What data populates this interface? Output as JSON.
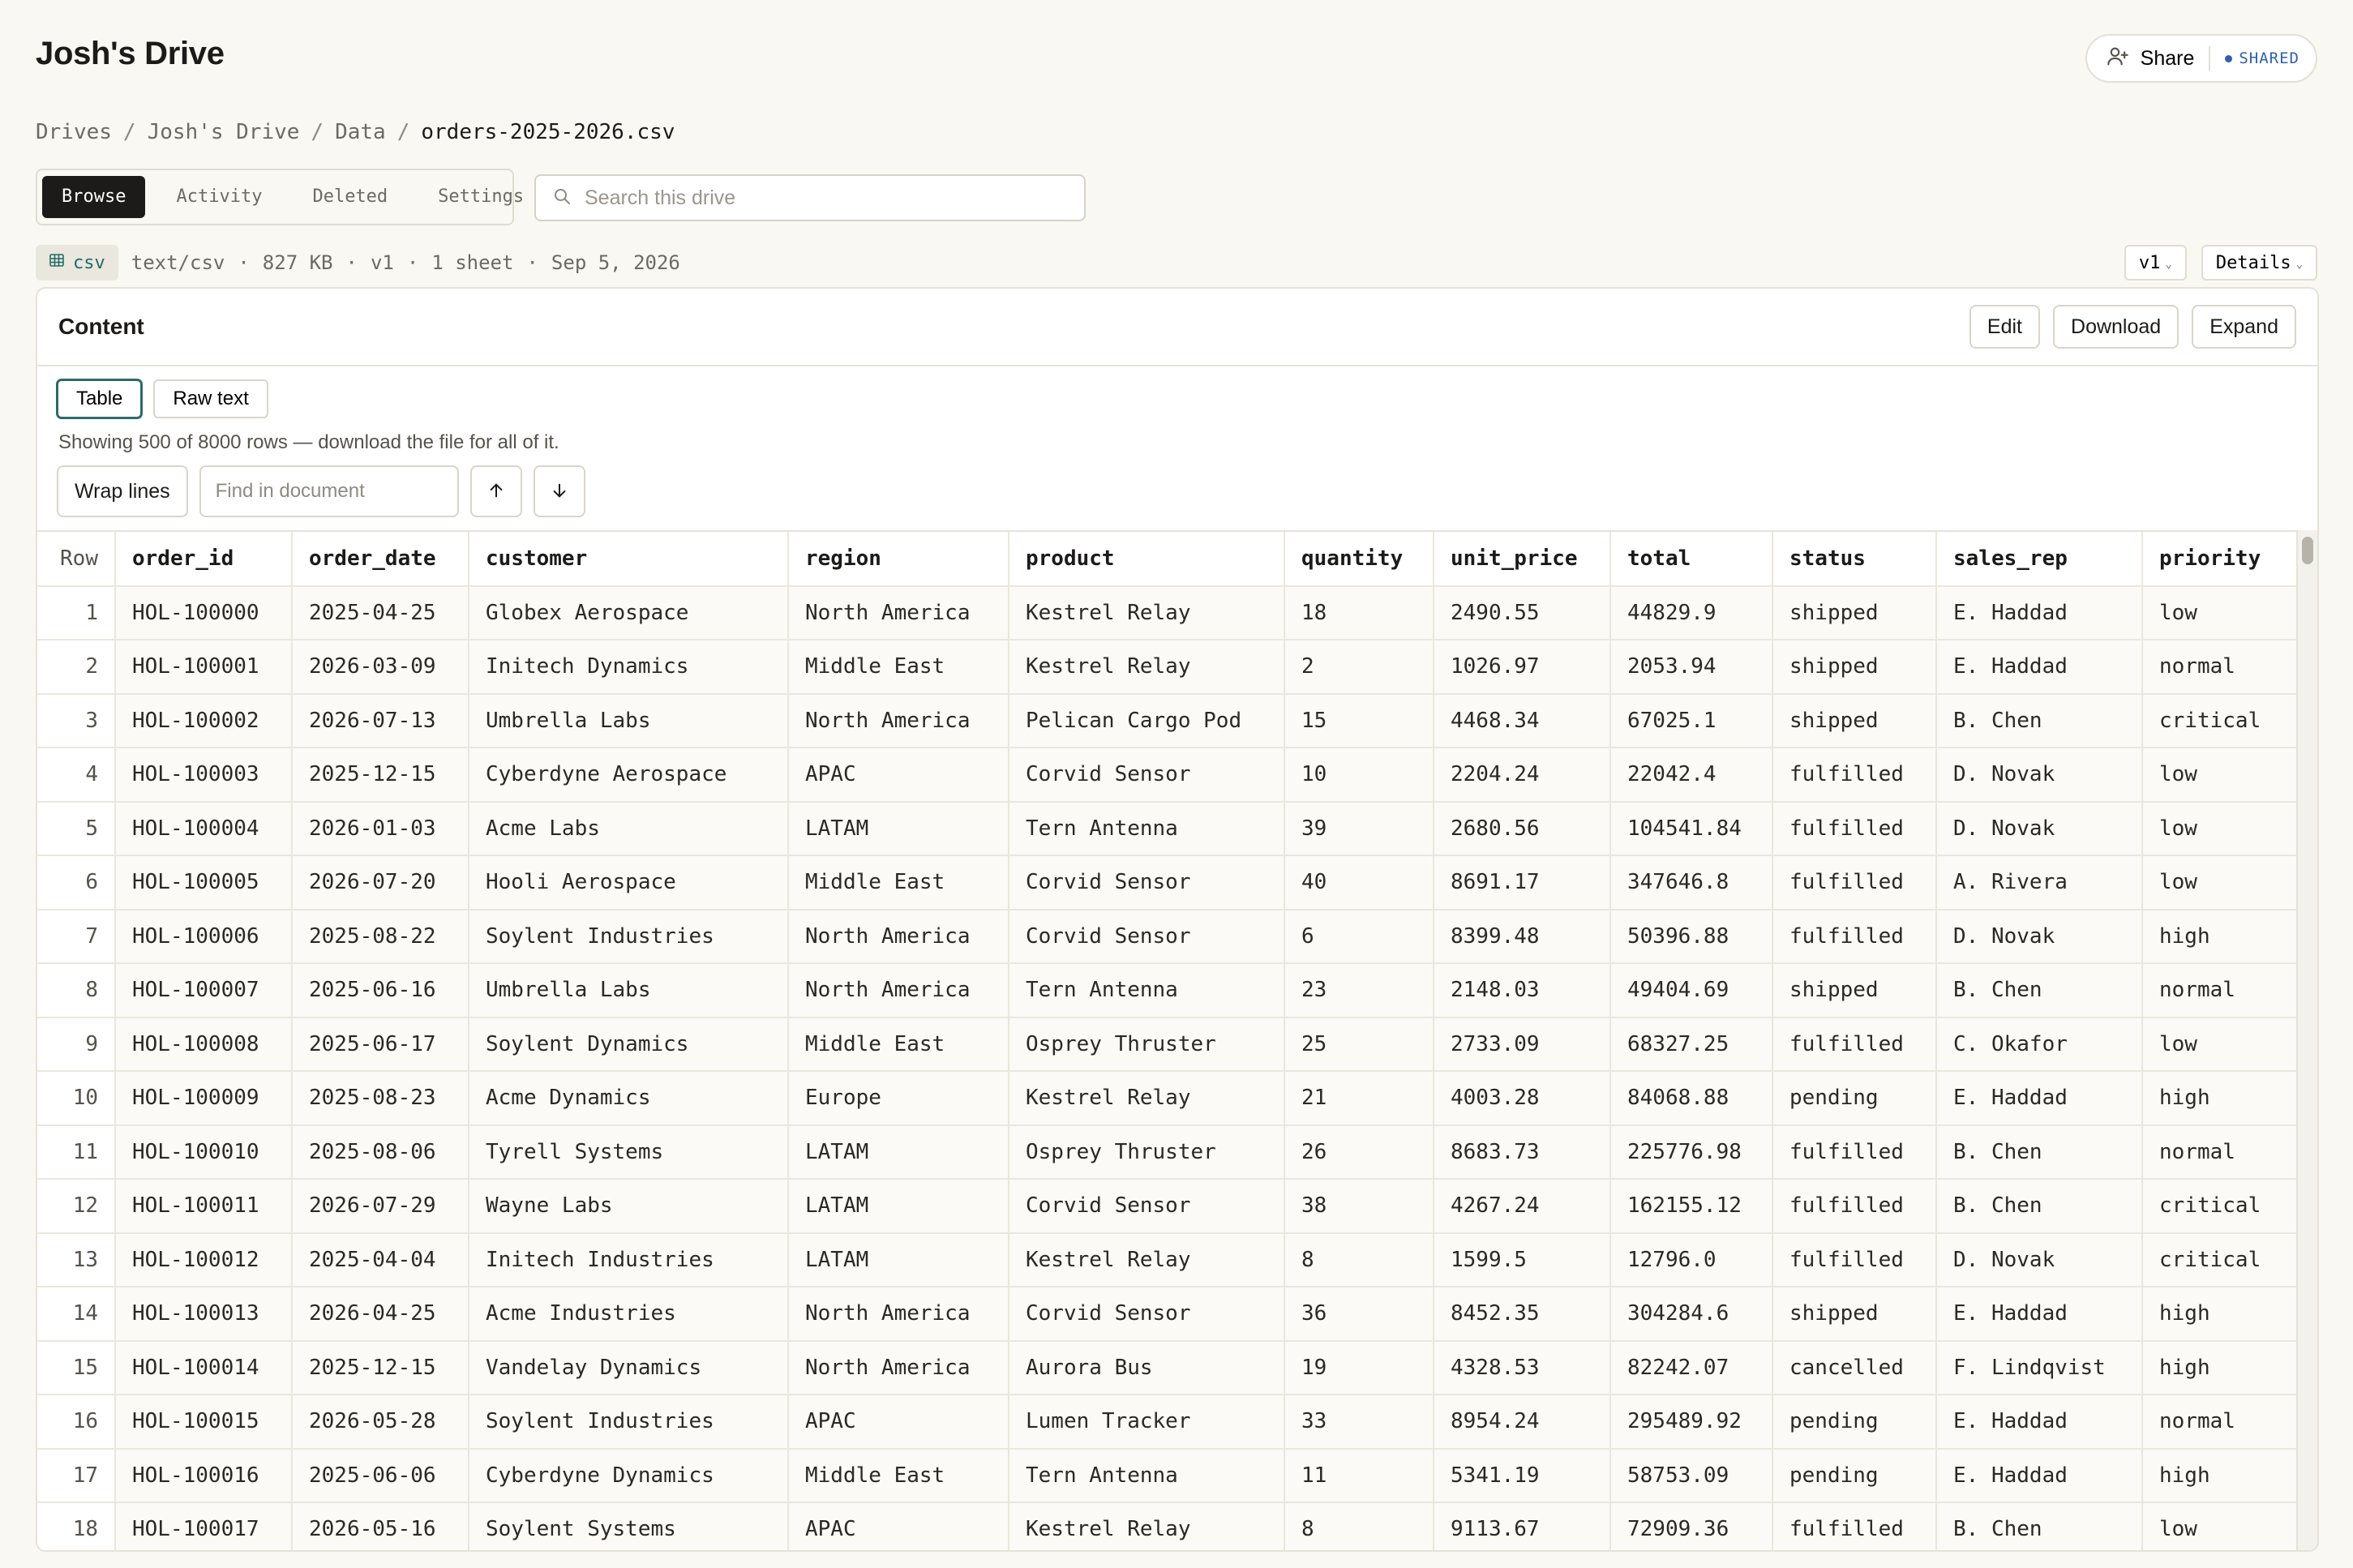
{
  "header": {
    "title": "Josh's Drive",
    "share_label": "Share",
    "shared_badge": "SHARED"
  },
  "breadcrumb": [
    "Drives",
    "Josh's Drive",
    "Data",
    "orders-2025-2026.csv"
  ],
  "tabs": [
    "Browse",
    "Activity",
    "Deleted",
    "Settings"
  ],
  "search": {
    "placeholder": "Search this drive"
  },
  "file_meta": {
    "type_badge": "csv",
    "mime": "text/csv",
    "size": "827 KB",
    "version": "v1",
    "sheets": "1 sheet",
    "date": "Sep 5, 2026",
    "version_select": "v1",
    "details_label": "Details"
  },
  "content": {
    "title": "Content",
    "actions": [
      "Edit",
      "Download",
      "Expand"
    ],
    "views": [
      "Table",
      "Raw text"
    ],
    "showing_text": "Showing 500 of 8000 rows — download the file for all of it.",
    "wrap_label": "Wrap lines",
    "find_placeholder": "Find in document"
  },
  "table": {
    "columns": [
      "Row",
      "order_id",
      "order_date",
      "customer",
      "region",
      "product",
      "quantity",
      "unit_price",
      "total",
      "status",
      "sales_rep",
      "priority"
    ],
    "rows": [
      [
        "1",
        "HOL-100000",
        "2025-04-25",
        "Globex Aerospace",
        "North America",
        "Kestrel Relay",
        "18",
        "2490.55",
        "44829.9",
        "shipped",
        "E. Haddad",
        "low"
      ],
      [
        "2",
        "HOL-100001",
        "2026-03-09",
        "Initech Dynamics",
        "Middle East",
        "Kestrel Relay",
        "2",
        "1026.97",
        "2053.94",
        "shipped",
        "E. Haddad",
        "normal"
      ],
      [
        "3",
        "HOL-100002",
        "2026-07-13",
        "Umbrella Labs",
        "North America",
        "Pelican Cargo Pod",
        "15",
        "4468.34",
        "67025.1",
        "shipped",
        "B. Chen",
        "critical"
      ],
      [
        "4",
        "HOL-100003",
        "2025-12-15",
        "Cyberdyne Aerospace",
        "APAC",
        "Corvid Sensor",
        "10",
        "2204.24",
        "22042.4",
        "fulfilled",
        "D. Novak",
        "low"
      ],
      [
        "5",
        "HOL-100004",
        "2026-01-03",
        "Acme Labs",
        "LATAM",
        "Tern Antenna",
        "39",
        "2680.56",
        "104541.84",
        "fulfilled",
        "D. Novak",
        "low"
      ],
      [
        "6",
        "HOL-100005",
        "2026-07-20",
        "Hooli Aerospace",
        "Middle East",
        "Corvid Sensor",
        "40",
        "8691.17",
        "347646.8",
        "fulfilled",
        "A. Rivera",
        "low"
      ],
      [
        "7",
        "HOL-100006",
        "2025-08-22",
        "Soylent Industries",
        "North America",
        "Corvid Sensor",
        "6",
        "8399.48",
        "50396.88",
        "fulfilled",
        "D. Novak",
        "high"
      ],
      [
        "8",
        "HOL-100007",
        "2025-06-16",
        "Umbrella Labs",
        "North America",
        "Tern Antenna",
        "23",
        "2148.03",
        "49404.69",
        "shipped",
        "B. Chen",
        "normal"
      ],
      [
        "9",
        "HOL-100008",
        "2025-06-17",
        "Soylent Dynamics",
        "Middle East",
        "Osprey Thruster",
        "25",
        "2733.09",
        "68327.25",
        "fulfilled",
        "C. Okafor",
        "low"
      ],
      [
        "10",
        "HOL-100009",
        "2025-08-23",
        "Acme Dynamics",
        "Europe",
        "Kestrel Relay",
        "21",
        "4003.28",
        "84068.88",
        "pending",
        "E. Haddad",
        "high"
      ],
      [
        "11",
        "HOL-100010",
        "2025-08-06",
        "Tyrell Systems",
        "LATAM",
        "Osprey Thruster",
        "26",
        "8683.73",
        "225776.98",
        "fulfilled",
        "B. Chen",
        "normal"
      ],
      [
        "12",
        "HOL-100011",
        "2026-07-29",
        "Wayne Labs",
        "LATAM",
        "Corvid Sensor",
        "38",
        "4267.24",
        "162155.12",
        "fulfilled",
        "B. Chen",
        "critical"
      ],
      [
        "13",
        "HOL-100012",
        "2025-04-04",
        "Initech Industries",
        "LATAM",
        "Kestrel Relay",
        "8",
        "1599.5",
        "12796.0",
        "fulfilled",
        "D. Novak",
        "critical"
      ],
      [
        "14",
        "HOL-100013",
        "2026-04-25",
        "Acme Industries",
        "North America",
        "Corvid Sensor",
        "36",
        "8452.35",
        "304284.6",
        "shipped",
        "E. Haddad",
        "high"
      ],
      [
        "15",
        "HOL-100014",
        "2025-12-15",
        "Vandelay Dynamics",
        "North America",
        "Aurora Bus",
        "19",
        "4328.53",
        "82242.07",
        "cancelled",
        "F. Lindqvist",
        "high"
      ],
      [
        "16",
        "HOL-100015",
        "2026-05-28",
        "Soylent Industries",
        "APAC",
        "Lumen Tracker",
        "33",
        "8954.24",
        "295489.92",
        "pending",
        "E. Haddad",
        "normal"
      ],
      [
        "17",
        "HOL-100016",
        "2025-06-06",
        "Cyberdyne Dynamics",
        "Middle East",
        "Tern Antenna",
        "11",
        "5341.19",
        "58753.09",
        "pending",
        "E. Haddad",
        "high"
      ],
      [
        "18",
        "HOL-100017",
        "2026-05-16",
        "Soylent Systems",
        "APAC",
        "Kestrel Relay",
        "8",
        "9113.67",
        "72909.36",
        "fulfilled",
        "B. Chen",
        "low"
      ]
    ]
  }
}
